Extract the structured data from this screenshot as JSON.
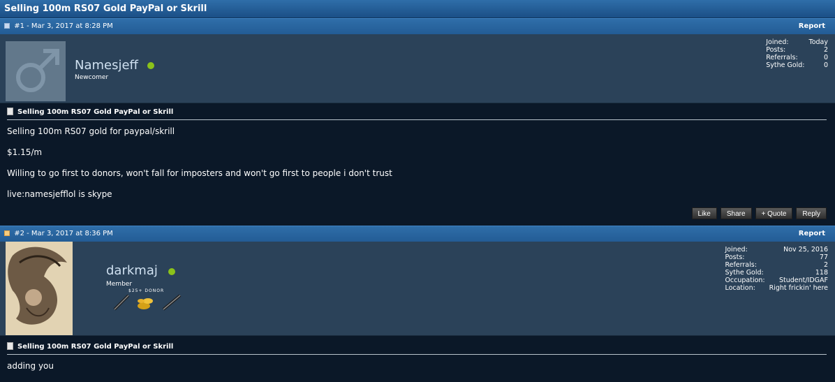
{
  "thread": {
    "title": "Selling 100m RS07 Gold PayPal or Skrill"
  },
  "posts": [
    {
      "header": "#1 - Mar 3, 2017 at 8:28 PM",
      "report": "Report",
      "username": "Namesjeff",
      "usertitle": "Newcomer",
      "stats": [
        {
          "label": "Joined:",
          "value": "Today"
        },
        {
          "label": "Posts:",
          "value": "2"
        },
        {
          "label": "Referrals:",
          "value": "0"
        },
        {
          "label": "Sythe Gold:",
          "value": "0"
        }
      ],
      "post_title": "Selling 100m RS07 Gold PayPal or Skrill",
      "lines": [
        "Selling 100m RS07 gold for paypal/skrill",
        "$1.15/m",
        "Willing to go first to donors, won't fall for imposters and won't go first to people i don't trust",
        "live:namesjefflol is skype"
      ],
      "actions": [
        "Like",
        "Share",
        "+ Quote",
        "Reply"
      ]
    },
    {
      "header": "#2 - Mar 3, 2017 at 8:36 PM",
      "report": "Report",
      "username": "darkmaj",
      "usertitle": "Member",
      "badge_text": "$25+ DONOR",
      "stats": [
        {
          "label": "Joined:",
          "value": "Nov 25, 2016"
        },
        {
          "label": "Posts:",
          "value": "77"
        },
        {
          "label": "Referrals:",
          "value": "2"
        },
        {
          "label": "Sythe Gold:",
          "value": "118"
        },
        {
          "label": "Occupation:",
          "value": "Student/IDGAF"
        },
        {
          "label": "Location:",
          "value": "Right frickin' here"
        }
      ],
      "post_title": "Selling 100m RS07 Gold PayPal or Skrill",
      "lines": [
        "adding you"
      ]
    }
  ],
  "colors": {
    "online": "#8bc21a",
    "header_blue": "#2f6ea9",
    "user_panel": "#2b4259",
    "body_bg": "#0b1828"
  },
  "icons": [
    "male-avatar-icon",
    "post-icon",
    "document-icon",
    "sword-icon",
    "gold-coins-icon"
  ]
}
